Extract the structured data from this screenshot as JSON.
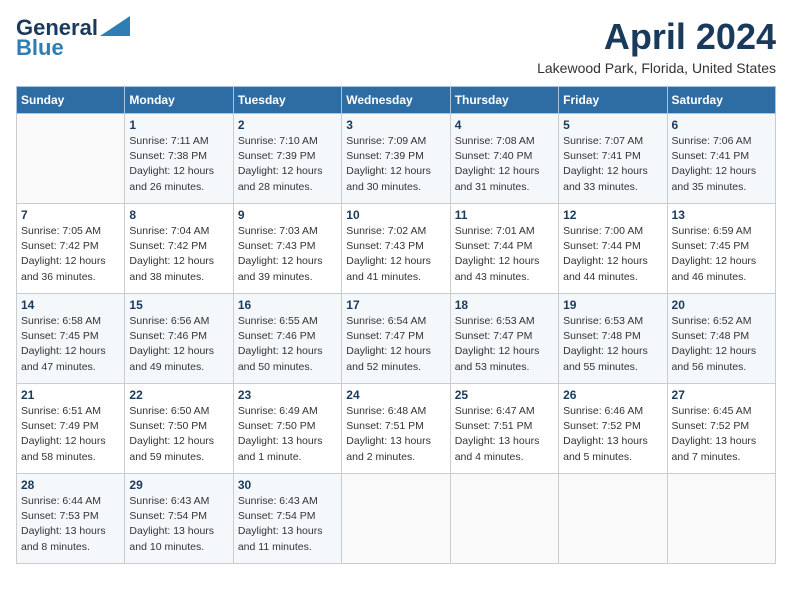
{
  "header": {
    "logo_line1": "General",
    "logo_line2": "Blue",
    "month": "April 2024",
    "location": "Lakewood Park, Florida, United States"
  },
  "weekdays": [
    "Sunday",
    "Monday",
    "Tuesday",
    "Wednesday",
    "Thursday",
    "Friday",
    "Saturday"
  ],
  "weeks": [
    [
      {
        "day": "",
        "info": ""
      },
      {
        "day": "1",
        "info": "Sunrise: 7:11 AM\nSunset: 7:38 PM\nDaylight: 12 hours\nand 26 minutes."
      },
      {
        "day": "2",
        "info": "Sunrise: 7:10 AM\nSunset: 7:39 PM\nDaylight: 12 hours\nand 28 minutes."
      },
      {
        "day": "3",
        "info": "Sunrise: 7:09 AM\nSunset: 7:39 PM\nDaylight: 12 hours\nand 30 minutes."
      },
      {
        "day": "4",
        "info": "Sunrise: 7:08 AM\nSunset: 7:40 PM\nDaylight: 12 hours\nand 31 minutes."
      },
      {
        "day": "5",
        "info": "Sunrise: 7:07 AM\nSunset: 7:41 PM\nDaylight: 12 hours\nand 33 minutes."
      },
      {
        "day": "6",
        "info": "Sunrise: 7:06 AM\nSunset: 7:41 PM\nDaylight: 12 hours\nand 35 minutes."
      }
    ],
    [
      {
        "day": "7",
        "info": "Sunrise: 7:05 AM\nSunset: 7:42 PM\nDaylight: 12 hours\nand 36 minutes."
      },
      {
        "day": "8",
        "info": "Sunrise: 7:04 AM\nSunset: 7:42 PM\nDaylight: 12 hours\nand 38 minutes."
      },
      {
        "day": "9",
        "info": "Sunrise: 7:03 AM\nSunset: 7:43 PM\nDaylight: 12 hours\nand 39 minutes."
      },
      {
        "day": "10",
        "info": "Sunrise: 7:02 AM\nSunset: 7:43 PM\nDaylight: 12 hours\nand 41 minutes."
      },
      {
        "day": "11",
        "info": "Sunrise: 7:01 AM\nSunset: 7:44 PM\nDaylight: 12 hours\nand 43 minutes."
      },
      {
        "day": "12",
        "info": "Sunrise: 7:00 AM\nSunset: 7:44 PM\nDaylight: 12 hours\nand 44 minutes."
      },
      {
        "day": "13",
        "info": "Sunrise: 6:59 AM\nSunset: 7:45 PM\nDaylight: 12 hours\nand 46 minutes."
      }
    ],
    [
      {
        "day": "14",
        "info": "Sunrise: 6:58 AM\nSunset: 7:45 PM\nDaylight: 12 hours\nand 47 minutes."
      },
      {
        "day": "15",
        "info": "Sunrise: 6:56 AM\nSunset: 7:46 PM\nDaylight: 12 hours\nand 49 minutes."
      },
      {
        "day": "16",
        "info": "Sunrise: 6:55 AM\nSunset: 7:46 PM\nDaylight: 12 hours\nand 50 minutes."
      },
      {
        "day": "17",
        "info": "Sunrise: 6:54 AM\nSunset: 7:47 PM\nDaylight: 12 hours\nand 52 minutes."
      },
      {
        "day": "18",
        "info": "Sunrise: 6:53 AM\nSunset: 7:47 PM\nDaylight: 12 hours\nand 53 minutes."
      },
      {
        "day": "19",
        "info": "Sunrise: 6:53 AM\nSunset: 7:48 PM\nDaylight: 12 hours\nand 55 minutes."
      },
      {
        "day": "20",
        "info": "Sunrise: 6:52 AM\nSunset: 7:48 PM\nDaylight: 12 hours\nand 56 minutes."
      }
    ],
    [
      {
        "day": "21",
        "info": "Sunrise: 6:51 AM\nSunset: 7:49 PM\nDaylight: 12 hours\nand 58 minutes."
      },
      {
        "day": "22",
        "info": "Sunrise: 6:50 AM\nSunset: 7:50 PM\nDaylight: 12 hours\nand 59 minutes."
      },
      {
        "day": "23",
        "info": "Sunrise: 6:49 AM\nSunset: 7:50 PM\nDaylight: 13 hours\nand 1 minute."
      },
      {
        "day": "24",
        "info": "Sunrise: 6:48 AM\nSunset: 7:51 PM\nDaylight: 13 hours\nand 2 minutes."
      },
      {
        "day": "25",
        "info": "Sunrise: 6:47 AM\nSunset: 7:51 PM\nDaylight: 13 hours\nand 4 minutes."
      },
      {
        "day": "26",
        "info": "Sunrise: 6:46 AM\nSunset: 7:52 PM\nDaylight: 13 hours\nand 5 minutes."
      },
      {
        "day": "27",
        "info": "Sunrise: 6:45 AM\nSunset: 7:52 PM\nDaylight: 13 hours\nand 7 minutes."
      }
    ],
    [
      {
        "day": "28",
        "info": "Sunrise: 6:44 AM\nSunset: 7:53 PM\nDaylight: 13 hours\nand 8 minutes."
      },
      {
        "day": "29",
        "info": "Sunrise: 6:43 AM\nSunset: 7:54 PM\nDaylight: 13 hours\nand 10 minutes."
      },
      {
        "day": "30",
        "info": "Sunrise: 6:43 AM\nSunset: 7:54 PM\nDaylight: 13 hours\nand 11 minutes."
      },
      {
        "day": "",
        "info": ""
      },
      {
        "day": "",
        "info": ""
      },
      {
        "day": "",
        "info": ""
      },
      {
        "day": "",
        "info": ""
      }
    ]
  ]
}
